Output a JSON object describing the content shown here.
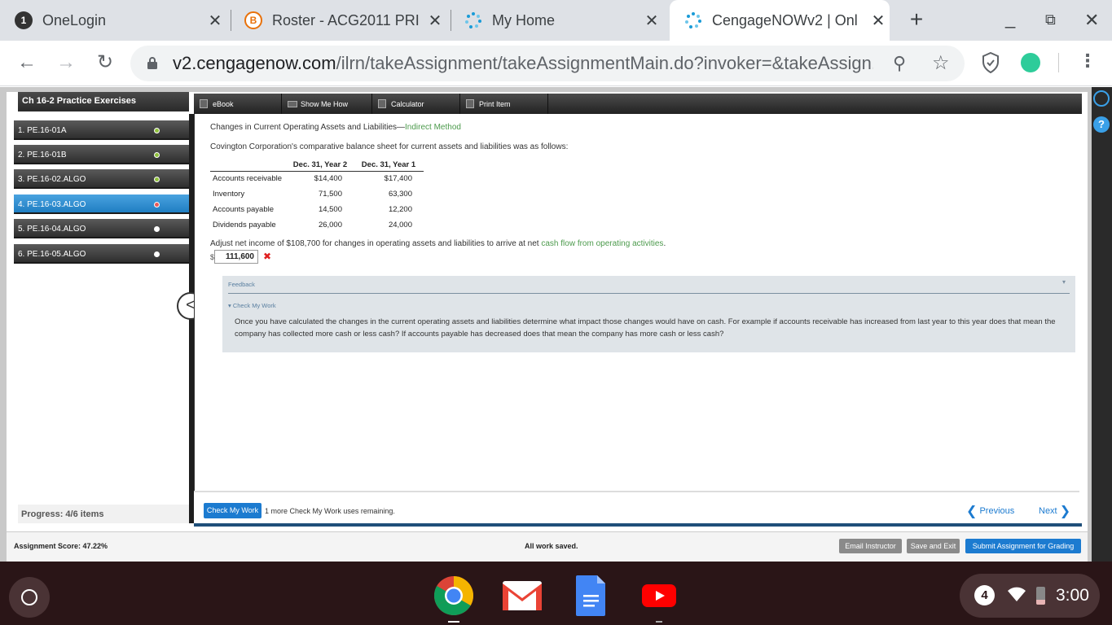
{
  "browser": {
    "tabs": [
      {
        "title": "OneLogin",
        "icon": "onelogin-icon",
        "favicon_text": "1"
      },
      {
        "title": "Roster - ACG2011 PRI",
        "icon": "roster-b-icon",
        "favicon_text": "B"
      },
      {
        "title": "My Home",
        "icon": "cengage-dots-icon"
      },
      {
        "title": "CengageNOWv2 | Onl",
        "icon": "cengage-dots-icon",
        "active": true
      }
    ],
    "url_host": "v2.cengagenow.com",
    "url_path": "/ilrn/takeAssignment/takeAssignmentMain.do?invoker=&takeAssign..."
  },
  "sidebar": {
    "title": "Ch 16-2 Practice Exercises",
    "items": [
      {
        "label": "1. PE.16-01A",
        "status": "correct"
      },
      {
        "label": "2. PE.16-01B",
        "status": "correct"
      },
      {
        "label": "3. PE.16-02.ALGO",
        "status": "correct"
      },
      {
        "label": "4. PE.16-03.ALGO",
        "status": "incorrect"
      },
      {
        "label": "5. PE.16-04.ALGO",
        "status": "unanswered"
      },
      {
        "label": "6. PE.16-05.ALGO",
        "status": "unanswered"
      }
    ],
    "progress": "Progress:  4/6 items"
  },
  "tools": [
    "eBook",
    "Show Me How",
    "Calculator",
    "Print Item"
  ],
  "question": {
    "title_main": "Changes in Current Operating Assets and Liabilities—",
    "title_link": "Indirect Method",
    "intro": "Covington Corporation's comparative balance sheet for current assets and liabilities was as follows:",
    "table": {
      "headers": [
        "",
        "Dec. 31, Year 2",
        "Dec. 31, Year 1"
      ],
      "rows": [
        [
          "Accounts receivable",
          "$14,400",
          "$17,400"
        ],
        [
          "Inventory",
          "71,500",
          "63,300"
        ],
        [
          "Accounts payable",
          "14,500",
          "12,200"
        ],
        [
          "Dividends payable",
          "26,000",
          "24,000"
        ]
      ]
    },
    "instruction_pre": "Adjust net income of $108,700 for changes in operating assets and liabilities to arrive at net ",
    "instruction_link": "cash flow from operating activities",
    "instruction_post": ".",
    "currency": "$",
    "answer": "111,600",
    "wrong_mark": "✖"
  },
  "feedback": {
    "title": "Feedback",
    "subtitle": "▾ Check My Work",
    "body": "Once you have calculated the changes in the current operating assets and liabilities determine what impact those changes would have on cash. For example if accounts receivable has increased from last year to this year does that mean the company has collected more cash or less cash? If accounts payable has decreased does that mean the company has more cash or less cash?"
  },
  "bottom": {
    "check_my_work": "Check My Work",
    "remaining": "1 more Check My Work uses remaining.",
    "previous": "Previous",
    "next": "Next"
  },
  "footer": {
    "score": "Assignment Score: 47.22%",
    "saved": "All work saved.",
    "email": "Email Instructor",
    "save_exit": "Save and Exit",
    "submit": "Submit Assignment for Grading"
  },
  "shelf": {
    "apps": [
      "chrome-icon",
      "gmail-icon",
      "docs-icon",
      "youtube-icon"
    ],
    "notifications": "4",
    "time": "3:00"
  },
  "colors": {
    "accent": "#1c7bd0",
    "selected_item": "#2b8fd6",
    "link_green": "#4c9a4c",
    "error": "#e02020"
  }
}
